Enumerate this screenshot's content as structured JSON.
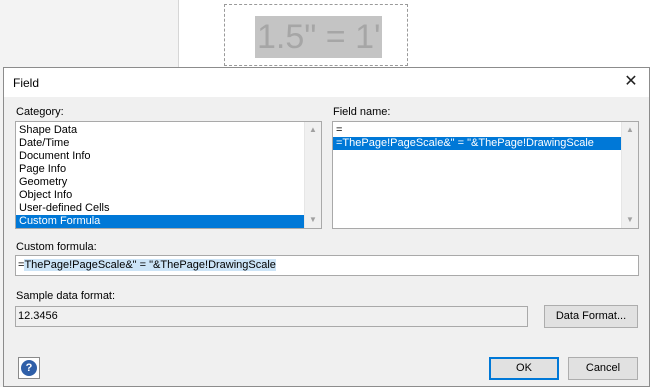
{
  "background": {
    "shape_text": "1.5\" = 1'"
  },
  "dialog": {
    "title": "Field",
    "close_symbol": "✕"
  },
  "category": {
    "label": "Category:",
    "items": [
      {
        "label": "Shape Data"
      },
      {
        "label": "Date/Time"
      },
      {
        "label": "Document Info"
      },
      {
        "label": "Page Info"
      },
      {
        "label": "Geometry"
      },
      {
        "label": "Object Info"
      },
      {
        "label": "User-defined Cells"
      },
      {
        "label": "Custom Formula"
      }
    ],
    "selected_index": 7
  },
  "field_name": {
    "label": "Field name:",
    "items": [
      {
        "label": "="
      },
      {
        "label": "=ThePage!PageScale&\" = \"&ThePage!DrawingScale"
      }
    ],
    "selected_index": 1
  },
  "custom_formula": {
    "label": "Custom formula:",
    "prefix": "=",
    "value": "ThePage!PageScale&\" = \"&ThePage!DrawingScale"
  },
  "sample_format": {
    "label": "Sample data format:",
    "value": "12.3456"
  },
  "buttons": {
    "data_format": "Data Format...",
    "ok": "OK",
    "cancel": "Cancel",
    "help": "?"
  },
  "scroll_arrows": {
    "up": "▲",
    "down": "▼"
  },
  "colors": {
    "selection": "#0078d7",
    "text_selection": "#cce4f7",
    "dialog_bg": "#f0f0f0"
  }
}
